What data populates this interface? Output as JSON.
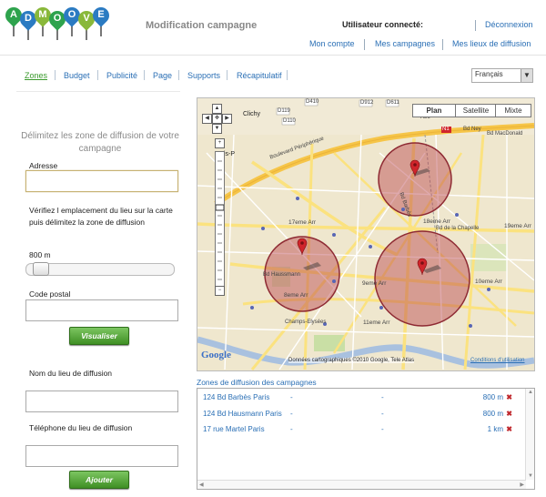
{
  "header": {
    "logo_letters": [
      "A",
      "D",
      "M",
      "O",
      "O",
      "V",
      "E"
    ],
    "logo_colors": [
      "#2ea34d",
      "#2b7bc2",
      "#89b83a",
      "#2ea34d",
      "#2b7bc2",
      "#89b83a",
      "#2b7bc2"
    ],
    "page_title": "Modification campagne",
    "user_label": "Utilisateur connecté:",
    "logout": "Déconnexion",
    "my_account": "Mon compte",
    "my_campaigns": "Mes campagnes",
    "my_places": "Mes lieux de diffusion"
  },
  "tabs": [
    {
      "label": "Zones",
      "active": true
    },
    {
      "label": "Budget",
      "active": false
    },
    {
      "label": "Publicité",
      "active": false
    },
    {
      "label": "Page",
      "active": false
    },
    {
      "label": "Supports",
      "active": false
    },
    {
      "label": "Récapitulatif",
      "active": false
    }
  ],
  "language": {
    "selected": "Français"
  },
  "form": {
    "intro": "Délimitez les zone de diffusion de votre campagne",
    "address_label": "Adresse",
    "address_value": "",
    "verify_text": "Vérifiez l emplacement du lieu sur la carte puis délimitez la zone de diffusion",
    "radius_label": "800 m",
    "radius_fraction": 0.05,
    "postal_label": "Code postal",
    "postal_value": "",
    "visualize_button": "Visualiser",
    "place_name_label": "Nom du lieu de diffusion",
    "place_name_value": "",
    "phone_label": "Téléphone du lieu de diffusion",
    "phone_value": "",
    "add_button": "Ajouter"
  },
  "map": {
    "types": [
      {
        "label": "Plan",
        "active": true
      },
      {
        "label": "Satellite",
        "active": false
      },
      {
        "label": "Mixte",
        "active": false
      }
    ],
    "labels": {
      "clichy": "Clichy",
      "is_prefix": "is-P",
      "d119": "D119",
      "d110": "D110",
      "d410": "D410",
      "d912": "D912",
      "d611": "D611",
      "a86": "A86",
      "bd_ney": "Bd Ney",
      "bd_mcdonald": "Bd MacDonald",
      "n1": "N1",
      "bd_peripherique": "Boulevard Périphérique",
      "arr17": "17eme Arr",
      "arr18": "18eme Arr",
      "arr19": "19eme Arr",
      "arr8": "8eme Arr",
      "arr9": "9eme Arr",
      "arr10": "10eme Arr",
      "arr11": "11eme Arr",
      "bd_barbes": "Bd Barbès",
      "bd_chapelle": "Bd de la Chapelle",
      "bd_haussmann": "Bd Haussmann",
      "champs": "Champs-Elysées",
      "copyright": "Données cartographiques ©2010 Google, Tele Atlas",
      "terms": "Conditions d'utilisation",
      "google": "Google"
    },
    "circles_color": "#b9414a"
  },
  "zones": {
    "title": "Zones de diffusion des campagnes",
    "rows": [
      {
        "address": "124 Bd Barbès Paris",
        "c2": "-",
        "c3": "-",
        "radius": "800 m"
      },
      {
        "address": "124 Bd Hausmann Paris",
        "c2": "-",
        "c3": "-",
        "radius": "800 m"
      },
      {
        "address": "17 rue Martel Paris",
        "c2": "-",
        "c3": "-",
        "radius": "1 km"
      }
    ]
  }
}
